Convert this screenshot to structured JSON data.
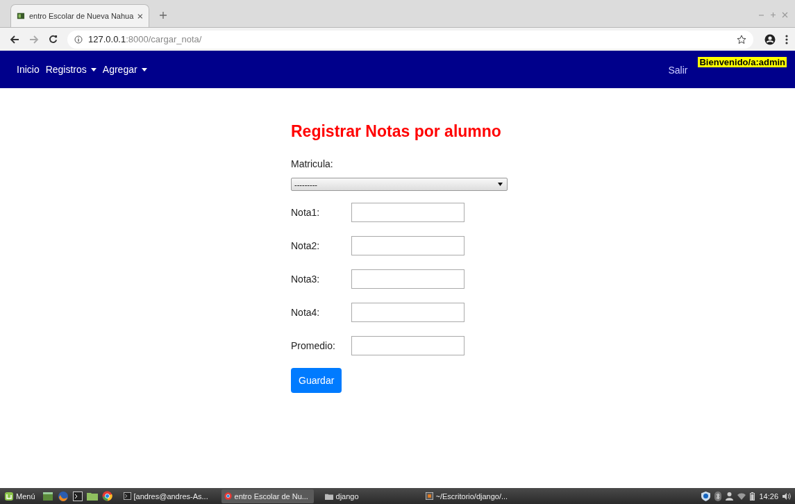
{
  "browser": {
    "tab": {
      "title": "entro Escolar de Nueva Nahua",
      "selected": true
    },
    "url": {
      "host": "127.0.0.1",
      "path": ":8000/cargar_nota/"
    }
  },
  "navbar": {
    "items": [
      {
        "label": "Inicio",
        "dropdown": false
      },
      {
        "label": "Registros",
        "dropdown": true
      },
      {
        "label": "Agregar",
        "dropdown": true
      }
    ],
    "logout": "Salir",
    "welcome": "Bienvenido/a:admin"
  },
  "form": {
    "title": "Registrar Notas por alumno",
    "select": {
      "label": "Matricula:",
      "value": "---------"
    },
    "fields": [
      {
        "label": "Nota1:"
      },
      {
        "label": "Nota2:"
      },
      {
        "label": "Nota3:"
      },
      {
        "label": "Nota4:"
      },
      {
        "label": "Promedio:"
      }
    ],
    "submit": "Guardar"
  },
  "taskbar": {
    "menu": "Menú",
    "tasks": [
      {
        "label": "[andres@andres-As...",
        "kind": "terminal",
        "selected": false
      },
      {
        "label": "entro Escolar de Nu...",
        "kind": "browser",
        "selected": true
      },
      {
        "label": "django",
        "kind": "folder",
        "selected": false
      },
      {
        "label": "~/Escritorio/django/...",
        "kind": "editor",
        "selected": false
      }
    ],
    "clock": "14:26"
  }
}
